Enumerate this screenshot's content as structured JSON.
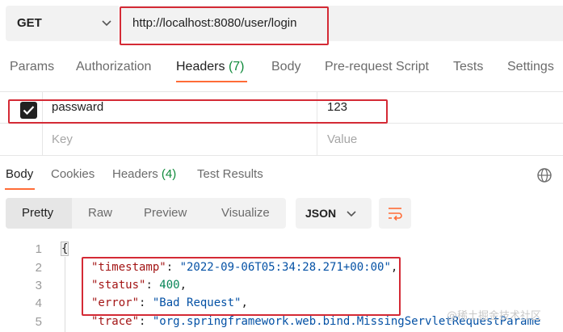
{
  "request": {
    "method": "GET",
    "url": "http://localhost:8080/user/login"
  },
  "request_tabs": [
    {
      "label": "Params"
    },
    {
      "label": "Authorization"
    },
    {
      "label": "Headers",
      "count": "(7)",
      "active": true
    },
    {
      "label": "Body"
    },
    {
      "label": "Pre-request Script"
    },
    {
      "label": "Tests"
    },
    {
      "label": "Settings"
    }
  ],
  "headers_table": {
    "rows": [
      {
        "checked": true,
        "key": "passward",
        "value": "123"
      }
    ],
    "placeholder": {
      "key": "Key",
      "value": "Value"
    }
  },
  "response_tabs": [
    {
      "label": "Body",
      "active": true
    },
    {
      "label": "Cookies"
    },
    {
      "label": "Headers",
      "count": "(4)"
    },
    {
      "label": "Test Results"
    }
  ],
  "view_modes": [
    "Pretty",
    "Raw",
    "Preview",
    "Visualize"
  ],
  "active_view_mode": "Pretty",
  "format": "JSON",
  "code": {
    "line_numbers": [
      "1",
      "2",
      "3",
      "4",
      "5"
    ],
    "open_brace": "{",
    "lines": [
      {
        "key": "\"timestamp\"",
        "value": "\"2022-09-06T05:34:28.271+00:00\""
      },
      {
        "key": "\"status\"",
        "value": "400"
      },
      {
        "key": "\"error\"",
        "value": "\"Bad Request\""
      },
      {
        "key": "\"trace\"",
        "value": "\"org.springframework.web.bind.MissingServletRequestParame"
      }
    ]
  },
  "watermark": "@稀土掘金技术社区",
  "colors": {
    "accent": "#ff6c37",
    "highlight_box": "#d42a35",
    "count_green": "#0f8a3b"
  }
}
